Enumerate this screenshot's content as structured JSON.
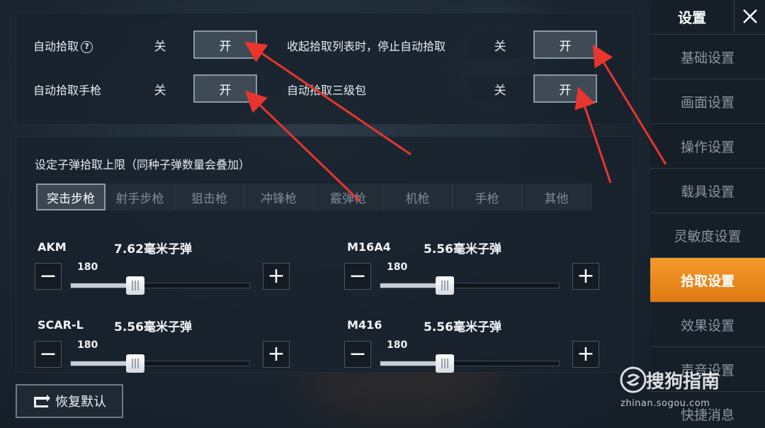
{
  "colors": {
    "accent": "#f29a2c",
    "arrow": "#e8352e"
  },
  "top_options": {
    "auto_pickup": {
      "label": "自动拾取",
      "off": "关",
      "on": "开"
    },
    "auto_pickup_pistol": {
      "label": "自动拾取手枪",
      "off": "关",
      "on": "开"
    },
    "stop_auto_pickup": {
      "label": "收起拾取列表时，停止自动拾取",
      "off": "关",
      "on": "开"
    },
    "auto_pickup_lvl3_pack": {
      "label": "自动拾取三级包",
      "off": "关",
      "on": "开"
    }
  },
  "ammo_section": {
    "title": "设定子弹拾取上限（同种子弹数量会叠加）",
    "tabs": [
      "突击步枪",
      "射手步枪",
      "狙击枪",
      "冲锋枪",
      "霰弹枪",
      "机枪",
      "手枪",
      "其他"
    ],
    "weapons": [
      {
        "name": "AKM",
        "ammo": "7.62毫米子弹",
        "value": "180",
        "level": 0.36
      },
      {
        "name": "M16A4",
        "ammo": "5.56毫米子弹",
        "value": "180",
        "level": 0.36
      },
      {
        "name": "SCAR-L",
        "ammo": "5.56毫米子弹",
        "value": "180",
        "level": 0.36
      },
      {
        "name": "M416",
        "ammo": "5.56毫米子弹",
        "value": "180",
        "level": 0.36
      }
    ]
  },
  "reset_button": {
    "label": "恢复默认"
  },
  "sidebar": {
    "title": "设置",
    "items": [
      "基础设置",
      "画面设置",
      "操作设置",
      "载具设置",
      "灵敏度设置",
      "拾取设置",
      "效果设置",
      "声音设置",
      "快捷消息"
    ],
    "active_index": 5
  },
  "watermark": {
    "brand": "搜狗指南",
    "url": "zhinan.sogou.com"
  }
}
